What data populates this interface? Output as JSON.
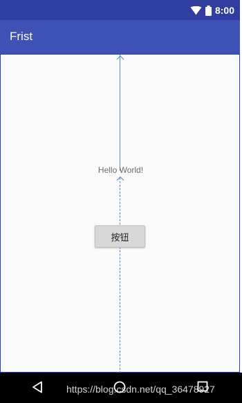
{
  "status_bar": {
    "time": "8:00",
    "icons": [
      "wifi-icon",
      "battery-icon"
    ],
    "background": "#303f9f"
  },
  "app_bar": {
    "title": "Frist",
    "background": "#3f51b5"
  },
  "content": {
    "hello_text": "Hello World!",
    "button_label": "按钮",
    "background": "#fafafa",
    "constraint_color": "#5b8fd0"
  },
  "nav_bar": {
    "icons": [
      "back-icon",
      "home-icon",
      "recents-icon"
    ]
  },
  "watermark": {
    "text": "https://blog.csdn.net/qq_36478927"
  }
}
